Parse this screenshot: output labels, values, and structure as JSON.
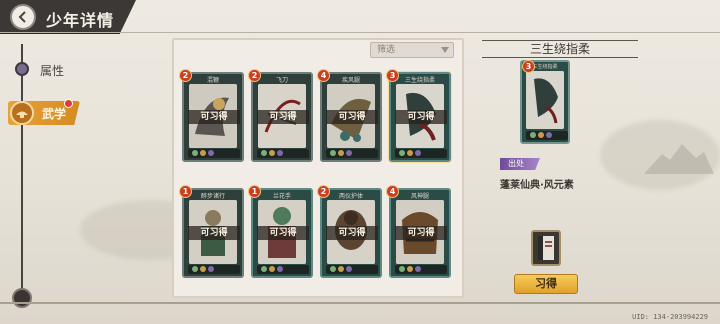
{
  "header": {
    "title": "少年详情"
  },
  "nav": {
    "items": [
      {
        "label": "属性",
        "active": false
      },
      {
        "label": "武学",
        "active": true,
        "badge": true
      }
    ]
  },
  "filter": {
    "label": "筛选"
  },
  "cards": [
    {
      "name": "混鞭",
      "level": "2",
      "status": "可习得",
      "theme": "dark"
    },
    {
      "name": "飞刀",
      "level": "2",
      "status": "可习得",
      "theme": "dark"
    },
    {
      "name": "疾风腿",
      "level": "4",
      "status": "可习得",
      "theme": "dark"
    },
    {
      "name": "三生绕指柔",
      "level": "3",
      "status": "可习得",
      "theme": "teal",
      "selected": true
    },
    {
      "name": "醉步诸行",
      "level": "1",
      "status": "可习得",
      "theme": "dark"
    },
    {
      "name": "兰花手",
      "level": "1",
      "status": "可习得",
      "theme": "teal"
    },
    {
      "name": "两仪护体",
      "level": "2",
      "status": "可习得",
      "theme": "teal"
    },
    {
      "name": "风神腿",
      "level": "4",
      "status": "可习得",
      "theme": "teal"
    }
  ],
  "detail": {
    "title": "三生绕指柔",
    "card_name": "三生绕指柔",
    "level": "3",
    "source_tag": "出处",
    "source_text": "蓬莱仙典·风元素",
    "learn_button": "习得"
  },
  "footer": {
    "uid": "UID: 134-203994229"
  },
  "colors": {
    "accent_gold": "#e0a129",
    "level_badge": "#c93f24",
    "source_tag": "#6d4c9b"
  }
}
